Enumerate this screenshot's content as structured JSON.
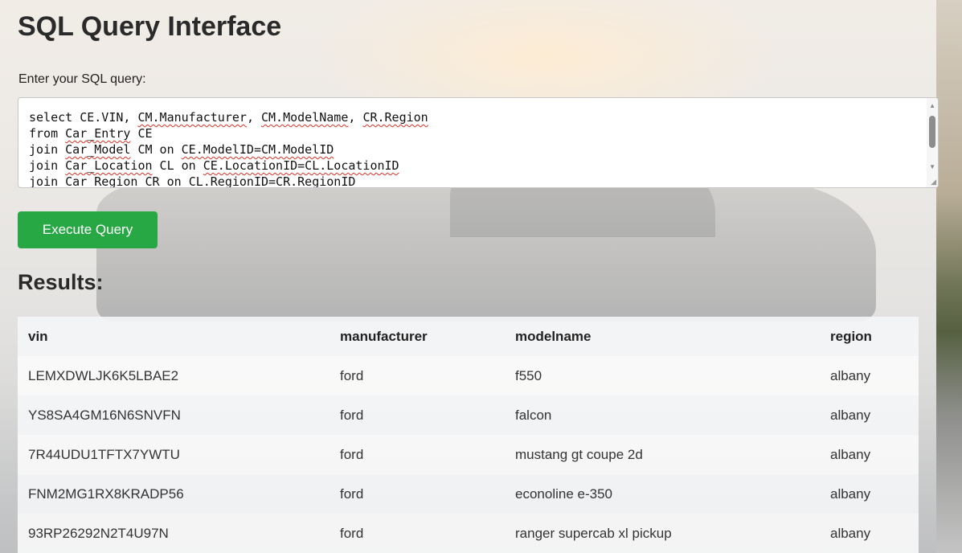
{
  "page": {
    "title": "SQL Query Interface",
    "query_label": "Enter your SQL query:",
    "execute_label": "Execute Query",
    "results_title": "Results:"
  },
  "query": {
    "lines": [
      "select CE.VIN, CM.Manufacturer, CM.ModelName, CR.Region",
      "from Car_Entry CE",
      "join Car_Model CM on CE.ModelID=CM.ModelID",
      "join Car_Location CL on CE.LocationID=CL.LocationID",
      "join Car_Region CR on CL.RegionID=CR.RegionID"
    ]
  },
  "results": {
    "columns": [
      "vin",
      "manufacturer",
      "modelname",
      "region"
    ],
    "rows": [
      [
        "LEMXDWLJK6K5LBAE2",
        "ford",
        "f550",
        "albany"
      ],
      [
        "YS8SA4GM16N6SNVFN",
        "ford",
        "falcon",
        "albany"
      ],
      [
        "7R44UDU1TFTX7YWTU",
        "ford",
        "mustang gt coupe 2d",
        "albany"
      ],
      [
        "FNM2MG1RX8KRADP56",
        "ford",
        "econoline e-350",
        "albany"
      ],
      [
        "93RP26292N2T4U97N",
        "ford",
        "ranger supercab xl pickup",
        "albany"
      ]
    ]
  },
  "colors": {
    "button": "#28a745",
    "spellcheck": "#d93025"
  }
}
